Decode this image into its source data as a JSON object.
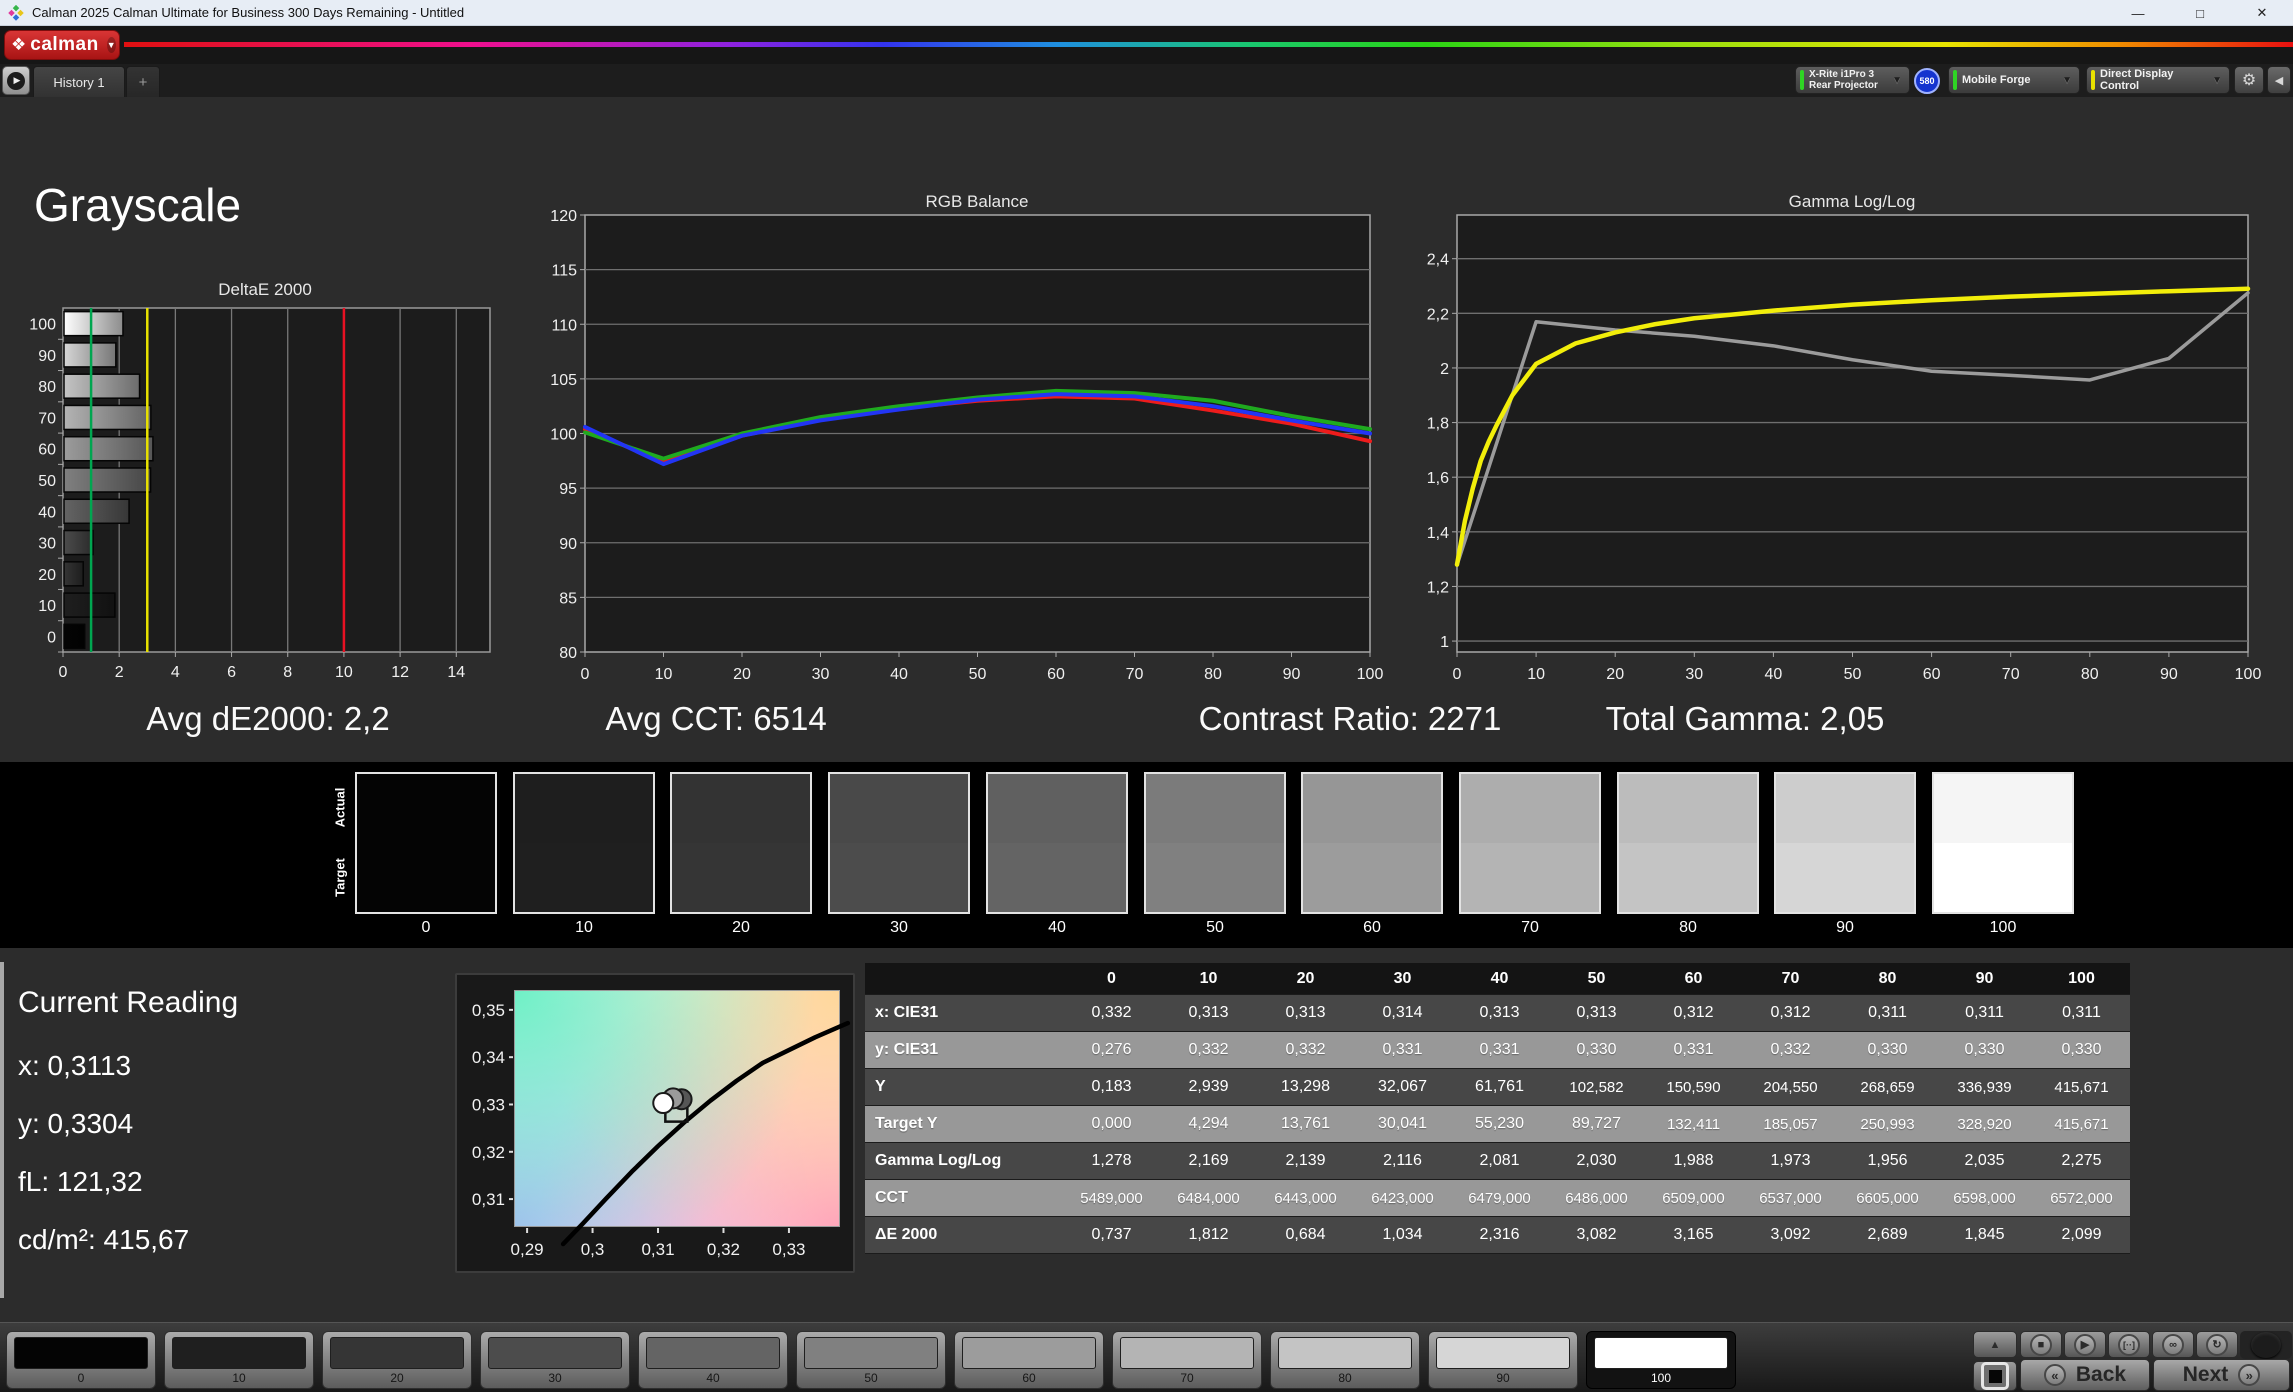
{
  "window": {
    "title": "Calman 2025 Calman Ultimate for Business 300 Days Remaining  - Untitled",
    "minimize": "—",
    "maximize": "□",
    "close": "✕"
  },
  "brand": {
    "name": "calman",
    "diamond": "❖",
    "caret": "▼"
  },
  "tabs": {
    "history": "History 1",
    "add": "+",
    "expand_icon": "▶"
  },
  "toolbar": {
    "meter": {
      "line1": "X-Rite i1Pro 3",
      "line2": "Rear Projector",
      "indicator": "#2fd424",
      "badge": "580"
    },
    "source": {
      "label": "Mobile Forge",
      "indicator": "#2fd424"
    },
    "display_control": {
      "label": "Direct Display Control",
      "indicator": "#e8e100"
    },
    "gear_icon": "⚙",
    "collapse_icon": "◀",
    "caret": "▼"
  },
  "page": {
    "title": "Grayscale"
  },
  "stats": {
    "avg_de": "Avg dE2000: 2,2",
    "avg_cct": "Avg CCT: 6514",
    "contrast": "Contrast Ratio: 2271",
    "total_gamma": "Total Gamma: 2,05"
  },
  "chart_data": [
    {
      "type": "bar",
      "orientation": "horizontal",
      "title": "DeltaE 2000",
      "categories": [
        "100",
        "90",
        "80",
        "70",
        "60",
        "50",
        "40",
        "30",
        "20",
        "10",
        "0"
      ],
      "values": [
        2.099,
        1.845,
        2.689,
        3.092,
        3.165,
        3.082,
        2.316,
        1.034,
        0.684,
        1.812,
        0.737
      ],
      "xlim": [
        0,
        15.2
      ],
      "xticks": [
        0,
        2,
        4,
        6,
        8,
        10,
        12,
        14
      ],
      "reference_lines": [
        {
          "value": 1,
          "color": "#00a650"
        },
        {
          "value": 3,
          "color": "#e8e100"
        },
        {
          "value": 10,
          "color": "#e81123"
        }
      ],
      "grid": true,
      "ylabel": "",
      "xlabel": ""
    },
    {
      "type": "line",
      "title": "RGB Balance",
      "x": [
        0,
        10,
        20,
        30,
        40,
        50,
        60,
        70,
        80,
        90,
        100
      ],
      "ylim": [
        80,
        120
      ],
      "yticks": [
        80,
        85,
        90,
        95,
        100,
        105,
        110,
        115,
        120
      ],
      "xticks": [
        0,
        10,
        20,
        30,
        40,
        50,
        60,
        70,
        80,
        90,
        100
      ],
      "series": [
        {
          "name": "Red",
          "color": "#ee1c1c",
          "values": [
            100.4,
            97.4,
            99.8,
            101.3,
            102.3,
            103.0,
            103.4,
            103.2,
            102.1,
            100.9,
            99.3
          ]
        },
        {
          "name": "Green",
          "color": "#1faa1f",
          "values": [
            100.1,
            97.7,
            100.0,
            101.5,
            102.5,
            103.3,
            103.9,
            103.7,
            103.0,
            101.6,
            100.4
          ]
        },
        {
          "name": "Blue",
          "color": "#2235f5",
          "values": [
            100.6,
            97.2,
            99.8,
            101.2,
            102.2,
            103.1,
            103.6,
            103.4,
            102.5,
            101.2,
            100.0
          ]
        }
      ],
      "grid": true
    },
    {
      "type": "line",
      "title": "Gamma Log/Log",
      "x": [
        0,
        10,
        20,
        30,
        40,
        50,
        60,
        70,
        80,
        90,
        100
      ],
      "ylim": [
        0.96,
        2.56
      ],
      "yticks": [
        1,
        1.2,
        1.4,
        1.6,
        1.8,
        2,
        2.2,
        2.4
      ],
      "ytick_labels": [
        "1",
        "1,2",
        "1,4",
        "1,6",
        "1,8",
        "2",
        "2,2",
        "2,4"
      ],
      "xticks": [
        0,
        10,
        20,
        30,
        40,
        50,
        60,
        70,
        80,
        90,
        100
      ],
      "series": [
        {
          "name": "Measured",
          "color": "#9b9b9b",
          "width": 3.5,
          "values": [
            1.278,
            2.169,
            2.139,
            2.116,
            2.081,
            2.03,
            1.988,
            1.973,
            1.956,
            2.035,
            2.275
          ]
        },
        {
          "name": "Target",
          "color": "#f2ee0a",
          "width": 4.5,
          "x": [
            0,
            1,
            2,
            3,
            4,
            5,
            7,
            10,
            15,
            20,
            25,
            30,
            40,
            50,
            60,
            70,
            80,
            90,
            100
          ],
          "values": [
            1.28,
            1.44,
            1.56,
            1.66,
            1.73,
            1.79,
            1.9,
            2.015,
            2.09,
            2.13,
            2.16,
            2.182,
            2.21,
            2.232,
            2.248,
            2.261,
            2.271,
            2.281,
            2.29
          ]
        }
      ],
      "grid": true
    },
    {
      "type": "scatter",
      "title": "CIE xy white point",
      "xlim": [
        0.288,
        0.3378
      ],
      "ylim": [
        0.3041,
        0.3542
      ],
      "xticks": [
        0.29,
        0.3,
        0.31,
        0.32,
        0.33
      ],
      "xtick_labels": [
        "0,29",
        "0,3",
        "0,31",
        "0,32",
        "0,33"
      ],
      "yticks": [
        0.31,
        0.32,
        0.33,
        0.34,
        0.35
      ],
      "ytick_labels": [
        "0,31",
        "0,32",
        "0,33",
        "0,34",
        "0,35"
      ],
      "locus": [
        [
          0.2955,
          0.3005
        ],
        [
          0.2985,
          0.3048
        ],
        [
          0.302,
          0.31
        ],
        [
          0.306,
          0.3158
        ],
        [
          0.31,
          0.3212
        ],
        [
          0.314,
          0.3262
        ],
        [
          0.318,
          0.3308
        ],
        [
          0.322,
          0.335
        ],
        [
          0.326,
          0.3388
        ],
        [
          0.33,
          0.3415
        ],
        [
          0.334,
          0.3442
        ],
        [
          0.339,
          0.3472
        ]
      ],
      "points": [
        {
          "x": 0.3136,
          "y": 0.3311,
          "fill": "#565656"
        },
        {
          "x": 0.3123,
          "y": 0.3313,
          "fill": "#9a9a9a"
        },
        {
          "x": 0.3108,
          "y": 0.3303,
          "fill": "#ffffff"
        }
      ],
      "target_square": {
        "x": 0.3128,
        "y": 0.3287
      }
    }
  ],
  "swatch_strip": {
    "row_labels": [
      "Actual",
      "Target"
    ],
    "levels": [
      "0",
      "10",
      "20",
      "30",
      "40",
      "50",
      "60",
      "70",
      "80",
      "90",
      "100"
    ],
    "tones": [
      "#040404",
      "#1f1f1f",
      "#353535",
      "#4c4c4c",
      "#646464",
      "#808080",
      "#9c9c9c",
      "#b4b4b4",
      "#c4c4c4",
      "#d6d6d6",
      "#ffffff"
    ]
  },
  "current_reading": {
    "title": "Current Reading",
    "items": [
      "x: 0,3113",
      "y: 0,3304",
      "fL: 121,32",
      "cd/m²: 415,67"
    ]
  },
  "table": {
    "columns": [
      "0",
      "10",
      "20",
      "30",
      "40",
      "50",
      "60",
      "70",
      "80",
      "90",
      "100"
    ],
    "rows": [
      {
        "label": "x: CIE31",
        "values": [
          "0,332",
          "0,313",
          "0,313",
          "0,314",
          "0,313",
          "0,313",
          "0,312",
          "0,312",
          "0,311",
          "0,311",
          "0,311"
        ]
      },
      {
        "label": "y: CIE31",
        "values": [
          "0,276",
          "0,332",
          "0,332",
          "0,331",
          "0,331",
          "0,330",
          "0,331",
          "0,332",
          "0,330",
          "0,330",
          "0,330"
        ]
      },
      {
        "label": "Y",
        "values": [
          "0,183",
          "2,939",
          "13,298",
          "32,067",
          "61,761",
          "102,582",
          "150,590",
          "204,550",
          "268,659",
          "336,939",
          "415,671"
        ]
      },
      {
        "label": "Target Y",
        "values": [
          "0,000",
          "4,294",
          "13,761",
          "30,041",
          "55,230",
          "89,727",
          "132,411",
          "185,057",
          "250,993",
          "328,920",
          "415,671"
        ]
      },
      {
        "label": "Gamma Log/Log",
        "values": [
          "1,278",
          "2,169",
          "2,139",
          "2,116",
          "2,081",
          "2,030",
          "1,988",
          "1,973",
          "1,956",
          "2,035",
          "2,275"
        ]
      },
      {
        "label": "CCT",
        "values": [
          "5489,000",
          "6484,000",
          "6443,000",
          "6423,000",
          "6479,000",
          "6486,000",
          "6509,000",
          "6537,000",
          "6605,000",
          "6598,000",
          "6572,000"
        ]
      },
      {
        "label": "ΔE 2000",
        "values": [
          "0,737",
          "1,812",
          "0,684",
          "1,034",
          "2,316",
          "3,082",
          "3,165",
          "3,092",
          "2,689",
          "1,845",
          "2,099"
        ]
      }
    ]
  },
  "bottom_bar": {
    "patterns": [
      "0",
      "10",
      "20",
      "30",
      "40",
      "50",
      "60",
      "70",
      "80",
      "90",
      "100"
    ],
    "selected": "100",
    "transport": {
      "up": "▲",
      "stop": "■",
      "play": "▶",
      "window_size": "[··]",
      "loop": "∞",
      "refresh": "↻"
    },
    "back": "Back",
    "next": "Next",
    "back_chevron": "«",
    "next_chevron": "»"
  }
}
